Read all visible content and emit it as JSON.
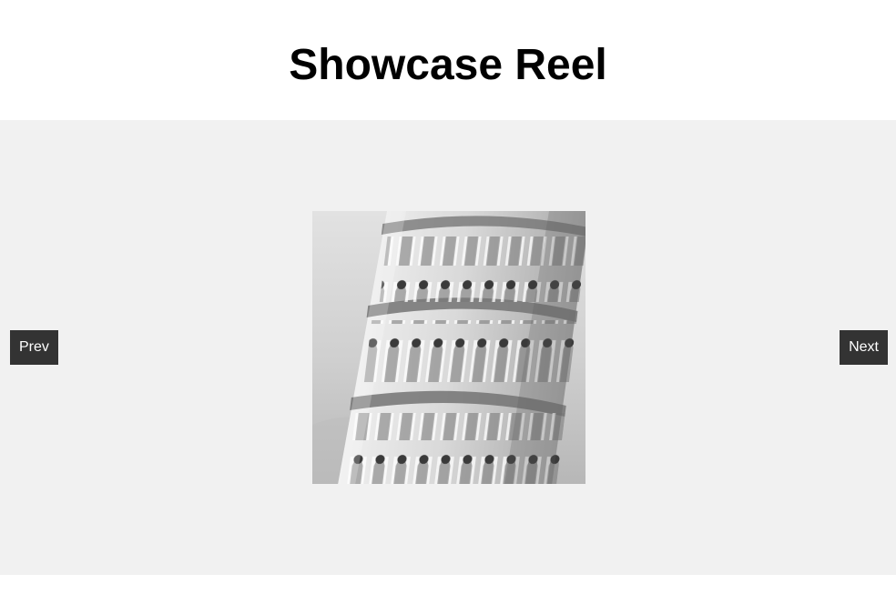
{
  "page": {
    "title": "Showcase Reel"
  },
  "carousel": {
    "prev_label": "Prev",
    "next_label": "Next",
    "slide": {
      "subject": "leaning-tower-photo",
      "style": "grayscale"
    }
  },
  "colors": {
    "carousel_background": "#f1f1f1",
    "button_background": "#333333",
    "button_text": "#ffffff"
  }
}
